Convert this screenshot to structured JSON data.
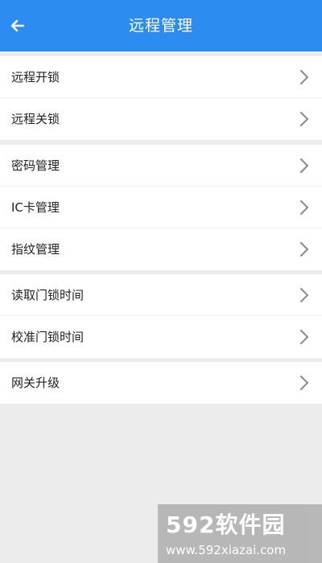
{
  "header": {
    "title": "远程管理",
    "back_icon": "arrow-left-icon"
  },
  "groups": [
    {
      "items": [
        {
          "label": "远程开锁",
          "icon": "chevron-right-icon"
        },
        {
          "label": "远程关锁",
          "icon": "chevron-right-icon"
        }
      ]
    },
    {
      "items": [
        {
          "label": "密码管理",
          "icon": "chevron-right-icon"
        },
        {
          "label": "IC卡管理",
          "icon": "chevron-right-icon"
        },
        {
          "label": "指纹管理",
          "icon": "chevron-right-icon"
        }
      ]
    },
    {
      "items": [
        {
          "label": "读取门锁时间",
          "icon": "chevron-right-icon"
        },
        {
          "label": "校准门锁时间",
          "icon": "chevron-right-icon"
        }
      ]
    },
    {
      "items": [
        {
          "label": "网关升级",
          "icon": "chevron-right-icon"
        }
      ]
    }
  ],
  "watermark": {
    "line1": "592软件园",
    "line2": "www.592xiazai.com"
  },
  "colors": {
    "header_bg": "#2d8cf0",
    "page_bg": "#ececec",
    "row_bg": "#ffffff",
    "text": "#222222",
    "chevron": "#8a8a8a"
  }
}
